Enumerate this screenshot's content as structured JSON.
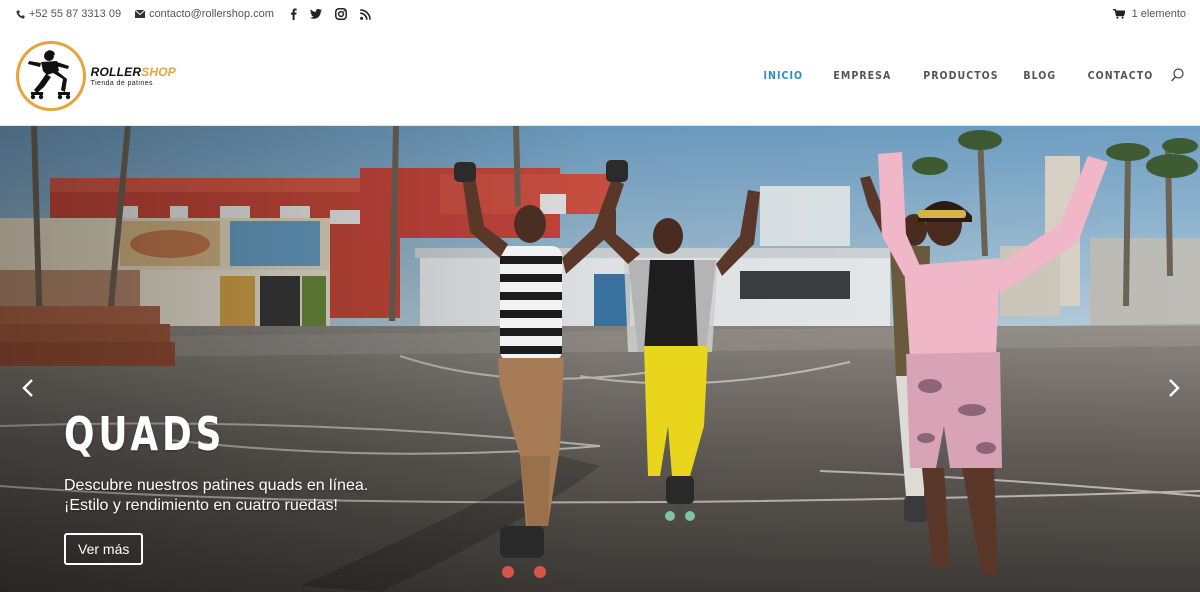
{
  "topbar": {
    "phone": "+52 55 87 3313 09",
    "email": "contacto@rollershop.com",
    "social_icons": [
      "facebook-icon",
      "twitter-icon",
      "instagram-icon",
      "rss-icon"
    ],
    "cart_label": "1 elemento"
  },
  "logo": {
    "name_part1": "ROLLER",
    "name_part2": "SHOP",
    "tagline": "Tienda de patines",
    "accent_color": "#e8a33a"
  },
  "nav": {
    "items": [
      {
        "label": "INICIO",
        "active": true
      },
      {
        "label": "EMPRESA",
        "active": false
      },
      {
        "label": "PRODUCTOS",
        "active": false
      },
      {
        "label": "BLOG",
        "active": false
      },
      {
        "label": "CONTACTO",
        "active": false
      }
    ],
    "active_color": "#2e8cc9",
    "search_icon": "search-icon"
  },
  "hero": {
    "title": "QUADS",
    "text_line1": "Descubre nuestros patines quads en línea.",
    "text_line2": "¡Estilo y rendimiento en cuatro ruedas!",
    "button_label": "Ver más",
    "prev_icon": "chevron-left-icon",
    "next_icon": "chevron-right-icon"
  }
}
